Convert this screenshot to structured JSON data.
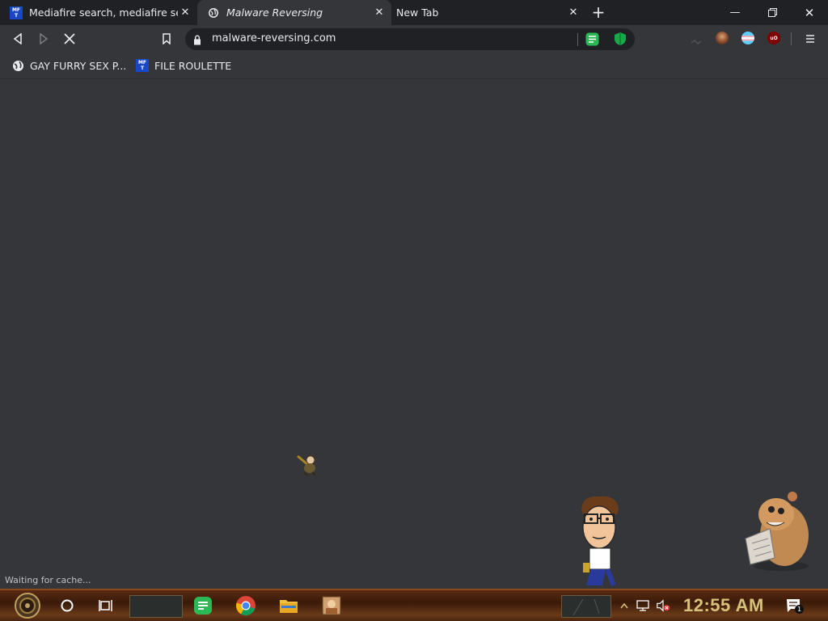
{
  "tabs": [
    {
      "title": "Mediafire search, mediafire sea",
      "favicon": "mft-favicon",
      "active": false
    },
    {
      "title": "Malware Reversing",
      "favicon": "globe-icon",
      "active": true
    },
    {
      "title": "New Tab",
      "favicon": "",
      "active": false
    }
  ],
  "mft_logo": {
    "line1": "MF",
    "line2": "T"
  },
  "address_bar": {
    "url": "malware-reversing.com"
  },
  "bookmarks": [
    {
      "label": "GAY FURRY SEX P...",
      "icon": "globe-icon"
    },
    {
      "label": "FILE ROULETTE",
      "icon": "mft-favicon"
    }
  ],
  "status_text": "Waiting for cache...",
  "taskbar": {
    "clock": "12:55 AM",
    "notification_count": "1"
  },
  "colors": {
    "tab_strip": "#202124",
    "toolbar": "#35363a",
    "content_background": "#35363a",
    "clock_text": "#d6c27a",
    "taskbar": "#5a2a12"
  }
}
